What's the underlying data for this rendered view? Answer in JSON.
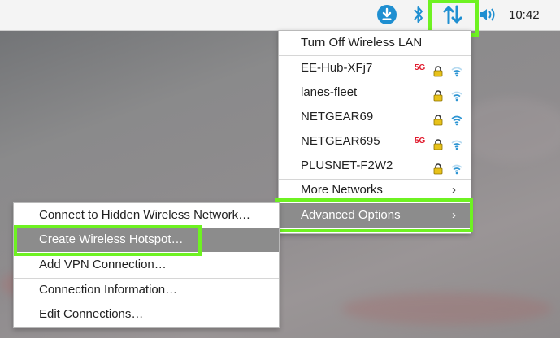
{
  "taskbar": {
    "clock": "10:42",
    "icons": [
      "download-icon",
      "bluetooth-icon",
      "network-icon",
      "volume-icon"
    ]
  },
  "network_menu": {
    "turn_off": "Turn Off Wireless LAN",
    "networks": [
      {
        "ssid": "EE-Hub-XFj7",
        "band": "5G",
        "secured": true
      },
      {
        "ssid": "lanes-fleet",
        "band": "",
        "secured": true
      },
      {
        "ssid": "NETGEAR69",
        "band": "",
        "secured": true
      },
      {
        "ssid": "NETGEAR695",
        "band": "5G",
        "secured": true
      },
      {
        "ssid": "PLUSNET-F2W2",
        "band": "",
        "secured": true
      }
    ],
    "more_networks": "More Networks",
    "advanced_options": "Advanced Options"
  },
  "advanced_submenu": {
    "items": [
      "Connect to Hidden Wireless Network…",
      "Create Wireless Hotspot…",
      "Add VPN Connection…",
      "Connection Information…",
      "Edit Connections…"
    ]
  },
  "colors": {
    "highlight_outline": "#6ef221",
    "selected_row": "#8c8c8c",
    "badge_5g": "#e0182b",
    "lock": "#e8c21a",
    "wifi": "#2e95d3"
  }
}
